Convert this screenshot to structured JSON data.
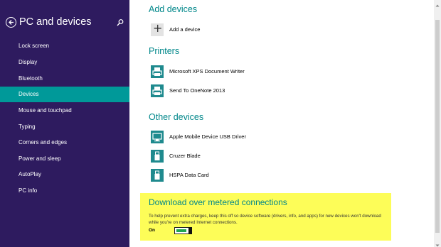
{
  "sidebar": {
    "title": "PC and devices",
    "items": [
      {
        "label": "Lock screen",
        "active": false
      },
      {
        "label": "Display",
        "active": false
      },
      {
        "label": "Bluetooth",
        "active": false
      },
      {
        "label": "Devices",
        "active": true
      },
      {
        "label": "Mouse and touchpad",
        "active": false
      },
      {
        "label": "Typing",
        "active": false
      },
      {
        "label": "Corners and edges",
        "active": false
      },
      {
        "label": "Power and sleep",
        "active": false
      },
      {
        "label": "AutoPlay",
        "active": false
      },
      {
        "label": "PC info",
        "active": false
      }
    ]
  },
  "add_devices": {
    "heading": "Add devices",
    "button_label": "Add a device"
  },
  "printers": {
    "heading": "Printers",
    "items": [
      {
        "label": "Microsoft XPS Document Writer",
        "icon": "printer-icon"
      },
      {
        "label": "Send To OneNote 2013",
        "icon": "printer-icon"
      }
    ]
  },
  "other_devices": {
    "heading": "Other devices",
    "items": [
      {
        "label": "Apple Mobile Device USB Driver",
        "icon": "monitor-icon"
      },
      {
        "label": "Cruzer Blade",
        "icon": "usb-drive-icon"
      },
      {
        "label": "HSPA Data Card",
        "icon": "usb-drive-icon"
      }
    ]
  },
  "metered": {
    "heading": "Download over metered connections",
    "description": "To help prevent extra charges, keep this off so device software (drivers, info, and apps) for new devices won't download while you're on metered Internet connections.",
    "toggle_state": "On",
    "toggle_on": true
  },
  "colors": {
    "sidebar_bg": "#2e1b5f",
    "active_item": "#009999",
    "heading": "#00878a",
    "highlight": "#fdfd58",
    "tile": "#1f8a8e"
  }
}
